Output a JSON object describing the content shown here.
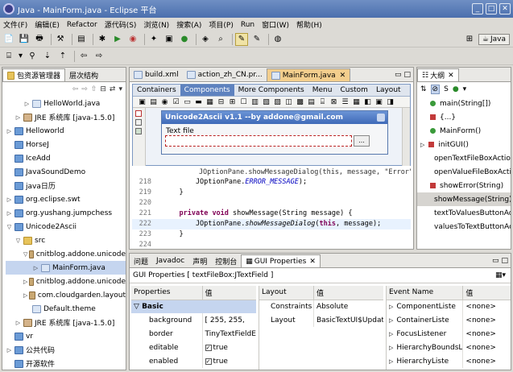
{
  "window": {
    "title": "Java - MainForm.java - Eclipse 平台"
  },
  "menu": [
    "文件(F)",
    "编辑(E)",
    "Refactor",
    "源代码(S)",
    "浏览(N)",
    "搜索(A)",
    "项目(P)",
    "Run",
    "窗口(W)",
    "帮助(H)"
  ],
  "perspective": {
    "label": "Java"
  },
  "package_explorer": {
    "tabs": [
      "包资源管理器",
      "层次结构"
    ],
    "rows": [
      {
        "indent": 2,
        "twisty": "▷",
        "icon": "file",
        "label": "HelloWorld.java"
      },
      {
        "indent": 1,
        "twisty": "▷",
        "icon": "lib",
        "label": "JRE 系统库  [java-1.5.0]"
      },
      {
        "indent": 0,
        "twisty": "▷",
        "icon": "proj",
        "label": "Helloworld"
      },
      {
        "indent": 0,
        "twisty": "",
        "icon": "proj",
        "label": "HorseJ"
      },
      {
        "indent": 0,
        "twisty": "",
        "icon": "proj",
        "label": "IceAdd"
      },
      {
        "indent": 0,
        "twisty": "",
        "icon": "proj",
        "label": "JavaSoundDemo"
      },
      {
        "indent": 0,
        "twisty": "",
        "icon": "proj",
        "label": "java日历"
      },
      {
        "indent": 0,
        "twisty": "▷",
        "icon": "proj",
        "label": "org.eclipse.swt"
      },
      {
        "indent": 0,
        "twisty": "▷",
        "icon": "proj",
        "label": "org.yushang.jumpchess"
      },
      {
        "indent": 0,
        "twisty": "▽",
        "icon": "proj",
        "label": "Unicode2Ascii"
      },
      {
        "indent": 1,
        "twisty": "▽",
        "icon": "folder",
        "label": "src"
      },
      {
        "indent": 2,
        "twisty": "▽",
        "icon": "pkg",
        "label": "cnitblog.addone.unicode"
      },
      {
        "indent": 3,
        "twisty": "▷",
        "icon": "file",
        "label": "MainForm.java"
      },
      {
        "indent": 2,
        "twisty": "▷",
        "icon": "pkg",
        "label": "cnitblog.addone.unicode"
      },
      {
        "indent": 2,
        "twisty": "▷",
        "icon": "pkg",
        "label": "com.cloudgarden.layout"
      },
      {
        "indent": 2,
        "twisty": "",
        "icon": "file",
        "label": "Default.theme"
      },
      {
        "indent": 1,
        "twisty": "▷",
        "icon": "lib",
        "label": "JRE 系统库  [java-1.5.0]"
      },
      {
        "indent": 0,
        "twisty": "",
        "icon": "proj",
        "label": "vr"
      },
      {
        "indent": 0,
        "twisty": "▷",
        "icon": "proj",
        "label": "公共代码"
      },
      {
        "indent": 0,
        "twisty": "",
        "icon": "proj",
        "label": "开源软件"
      }
    ]
  },
  "editor": {
    "tabs": [
      {
        "label": "build.xml",
        "active": false
      },
      {
        "label": "action_zh_CN.pr...",
        "active": false
      },
      {
        "label": "MainForm.java",
        "active": true
      }
    ],
    "palette_tabs": [
      "Containers",
      "Components",
      "More Components",
      "Menu",
      "Custom",
      "Layout"
    ],
    "preview": {
      "title": "Unicode2Ascii v1.1 --by addone@gmail.com",
      "label": "Text file",
      "button": "..."
    },
    "code_lines": [
      {
        "num": "218",
        "code": "        JOptionPane.ERROR_MESSAGE);"
      },
      {
        "num": "219",
        "code": "    }"
      },
      {
        "num": "220",
        "code": ""
      },
      {
        "num": "221",
        "code": "    private void showMessage(String message) {"
      },
      {
        "num": "222",
        "code": "        JOptionPane.showMessageDialog(this, message);"
      },
      {
        "num": "223",
        "code": "    }"
      },
      {
        "num": "224",
        "code": ""
      }
    ],
    "partial_line": "        JOptionPane.showMessageDialog(this, message, \"Error\","
  },
  "bottom": {
    "tabs": [
      "问题",
      "Javadoc",
      "声明",
      "控制台",
      "GUI Properties"
    ],
    "header": "GUI Properties [ textFileBox:JTextField ]",
    "props": {
      "columns": [
        "Properties",
        "值"
      ],
      "group": "Basic",
      "rows": [
        {
          "name": "background",
          "value": "[ 255, 255,"
        },
        {
          "name": "border",
          "value": "TinyTextFieldE"
        },
        {
          "name": "editable",
          "value": "true"
        },
        {
          "name": "enabled",
          "value": "true"
        }
      ]
    },
    "layout": {
      "columns": [
        "Layout",
        "值"
      ],
      "rows": [
        {
          "name": "Constraints",
          "value": "Absolute"
        },
        {
          "name": "Layout",
          "value": "BasicTextUI$Updat"
        }
      ]
    },
    "events": {
      "columns": [
        "Event Name",
        "值"
      ],
      "rows": [
        {
          "name": "ComponentListe",
          "value": "<none>"
        },
        {
          "name": "ContainerListe",
          "value": "<none>"
        },
        {
          "name": "FocusListener",
          "value": "<none>"
        },
        {
          "name": "HierarchyBoundsL",
          "value": "<none>"
        },
        {
          "name": "HierarchyListe",
          "value": "<none>"
        }
      ]
    }
  },
  "outline": {
    "tab": "大纲",
    "rows": [
      {
        "kind": "dot",
        "label": "main(String[])"
      },
      {
        "kind": "sq",
        "label": "{...}"
      },
      {
        "kind": "dot",
        "label": "MainForm()"
      },
      {
        "kind": "tw",
        "label": "initGUI()"
      },
      {
        "kind": "sq",
        "label": "openTextFileBoxAction"
      },
      {
        "kind": "sq",
        "label": "openValueFileBoxActio"
      },
      {
        "kind": "sq",
        "label": "showError(String)"
      },
      {
        "kind": "sq",
        "label": "showMessage(String)"
      },
      {
        "kind": "sq",
        "label": "textToValuesButtonAc"
      },
      {
        "kind": "sq",
        "label": "valuesToTextButtonAc"
      }
    ]
  },
  "colors": {
    "accent": "#316ac5",
    "selection": "#c5d5ef",
    "frame": "#9d9c98"
  }
}
